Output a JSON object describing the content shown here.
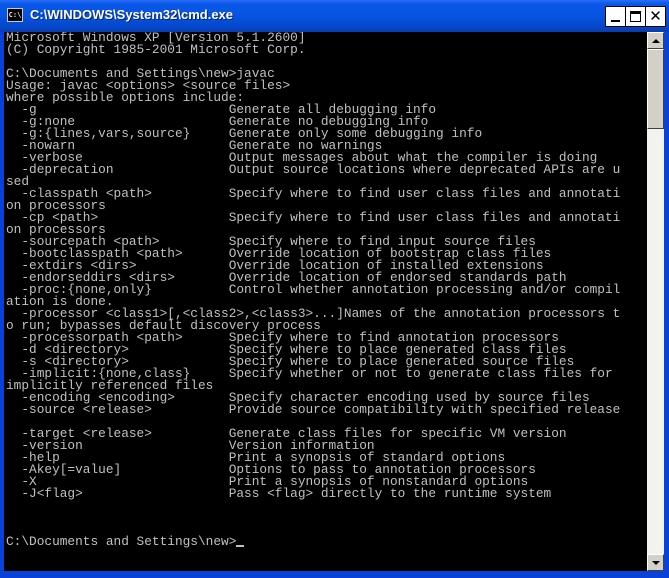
{
  "window": {
    "title": "C:\\WINDOWS\\System32\\cmd.exe",
    "icon": "cmd-icon",
    "icon_text": "C:\\",
    "buttons": {
      "minimize": "minimize-icon",
      "maximize": "maximize-icon",
      "close": "close-icon",
      "close_glyph": "✕"
    }
  },
  "console": {
    "lines": [
      "Microsoft Windows XP [Version 5.1.2600]",
      "(C) Copyright 1985-2001 Microsoft Corp.",
      "",
      "C:\\Documents and Settings\\new>javac",
      "Usage: javac <options> <source files>",
      "where possible options include:",
      "  -g                         Generate all debugging info",
      "  -g:none                    Generate no debugging info",
      "  -g:{lines,vars,source}     Generate only some debugging info",
      "  -nowarn                    Generate no warnings",
      "  -verbose                   Output messages about what the compiler is doing",
      "  -deprecation               Output source locations where deprecated APIs are u",
      "sed",
      "  -classpath <path>          Specify where to find user class files and annotati",
      "on processors",
      "  -cp <path>                 Specify where to find user class files and annotati",
      "on processors",
      "  -sourcepath <path>         Specify where to find input source files",
      "  -bootclasspath <path>      Override location of bootstrap class files",
      "  -extdirs <dirs>            Override location of installed extensions",
      "  -endorseddirs <dirs>       Override location of endorsed standards path",
      "  -proc:{none,only}          Control whether annotation processing and/or compil",
      "ation is done.",
      "  -processor <class1>[,<class2>,<class3>...]Names of the annotation processors t",
      "o run; bypasses default discovery process",
      "  -processorpath <path>      Specify where to find annotation processors",
      "  -d <directory>             Specify where to place generated class files",
      "  -s <directory>             Specify where to place generated source files",
      "  -implicit:{none,class}     Specify whether or not to generate class files for",
      "implicitly referenced files",
      "  -encoding <encoding>       Specify character encoding used by source files",
      "  -source <release>          Provide source compatibility with specified release",
      "",
      "  -target <release>          Generate class files for specific VM version",
      "  -version                   Version information",
      "  -help                      Print a synopsis of standard options",
      "  -Akey[=value]              Options to pass to annotation processors",
      "  -X                         Print a synopsis of nonstandard options",
      "  -J<flag>                   Pass <flag> directly to the runtime system",
      "",
      "",
      ""
    ],
    "prompt": "C:\\Documents and Settings\\new>"
  },
  "scrollbar": {
    "up": "arrow-up-icon",
    "down": "arrow-down-icon"
  }
}
